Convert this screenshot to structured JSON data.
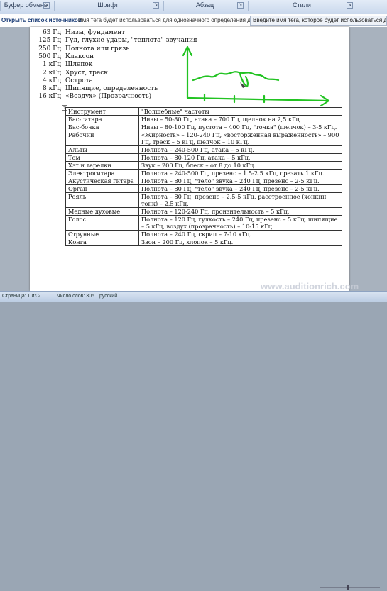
{
  "ribbon": {
    "groups": [
      {
        "label": "Буфер обмены"
      },
      {
        "label": "Шрифт"
      },
      {
        "label": "Абзац"
      },
      {
        "label": "Стили"
      }
    ]
  },
  "message_bar": {
    "open_sources": "Открыть список источников",
    "hint": "Имя тега будет использоваться для однозначного определения данн...",
    "input_placeholder": "Введите имя тега, которое будет использоваться для"
  },
  "background_list": [
    {
      "freq": "63 Гц",
      "desc": "Низы, фундамент"
    },
    {
      "freq": "125 Гц",
      "desc": "Гул, глухие удары, \"теплота\" звучания"
    },
    {
      "freq": "250 Гц",
      "desc": "Полнота или грязь"
    },
    {
      "freq": "500 Гц",
      "desc": "Клаксон"
    },
    {
      "freq": "1 кГц",
      "desc": "Шлепок"
    },
    {
      "freq": "2 кГц",
      "desc": "Хруст, треск"
    },
    {
      "freq": "4 кГц",
      "desc": "Острота"
    },
    {
      "freq": "8 кГц",
      "desc": "Шипящие, определенность"
    },
    {
      "freq": "16 кГц",
      "desc": "«Воздух» (Прозрачность)"
    }
  ],
  "table": {
    "headers": [
      "Инструмент",
      "\"Волшебные\" частоты"
    ],
    "rows": [
      [
        "Бас-гитара",
        "Низы – 50-80 Гц, атака – 700 Гц, щелчок на 2,5 кГц"
      ],
      [
        "Бас-бочка",
        "Низы – 80-100 Гц, пустота – 400 Гц, \"точка\" (щелчок) – 3-5 кГц."
      ],
      [
        "Рабочий",
        "«Жирность» – 120-240 Гц, «восторженная выраженность» – 900 Гц, треск – 5 кГц, щелчок – 10 кГц."
      ],
      [
        "Альты",
        "Полнота – 240-500 Гц, атака – 5 кГц."
      ],
      [
        "Том",
        "Полнота – 80-120 Гц, атака – 5 кГц."
      ],
      [
        "Хэт и тарелки",
        "Звук – 200 Гц, блеск – от 8 до 10 кГц."
      ],
      [
        "Электрогитара",
        "Полнота – 240-500 Гц, презенс – 1.5-2.5 кГц, срезать 1 кГц."
      ],
      [
        "Акустическая гитара",
        "Полнота – 80 Гц, \"тело\" звука – 240 Гц, презенс – 2-5 кГц."
      ],
      [
        "Орган",
        "Полнота – 80 Гц, \"тело\" звука – 240 Гц, презенс – 2-5 кГц."
      ],
      [
        "Рояль",
        "Полнота – 80 Гц, презенс – 2,5-5 кГц, расстроенное (хонкин тонк) – 2,5 кГц."
      ],
      [
        "Медные духовые",
        "Полнота – 120-240 Гц, пронзительность – 5 кГц."
      ],
      [
        "Голос",
        "Полнота – 120 Гц, гулкость – 240 Гц, презенс – 5 кГц, шипящие – 5 кГц, воздух (прозрачность) – 10-15 кГц."
      ],
      [
        "Струнные",
        "Полнота – 240 Гц, скрип – 7-10 кГц."
      ],
      [
        "Конга",
        "Звон – 200 Гц, хлопок – 5 кГц."
      ]
    ]
  },
  "status_bar": {
    "page": "Страница: 1 из 2",
    "words": "Число слов: 305",
    "language": "русский"
  },
  "watermark": "www.auditionrich.com",
  "colors": {
    "annotation": "#22c322",
    "ribbon_bg": "#d5e2f2"
  }
}
